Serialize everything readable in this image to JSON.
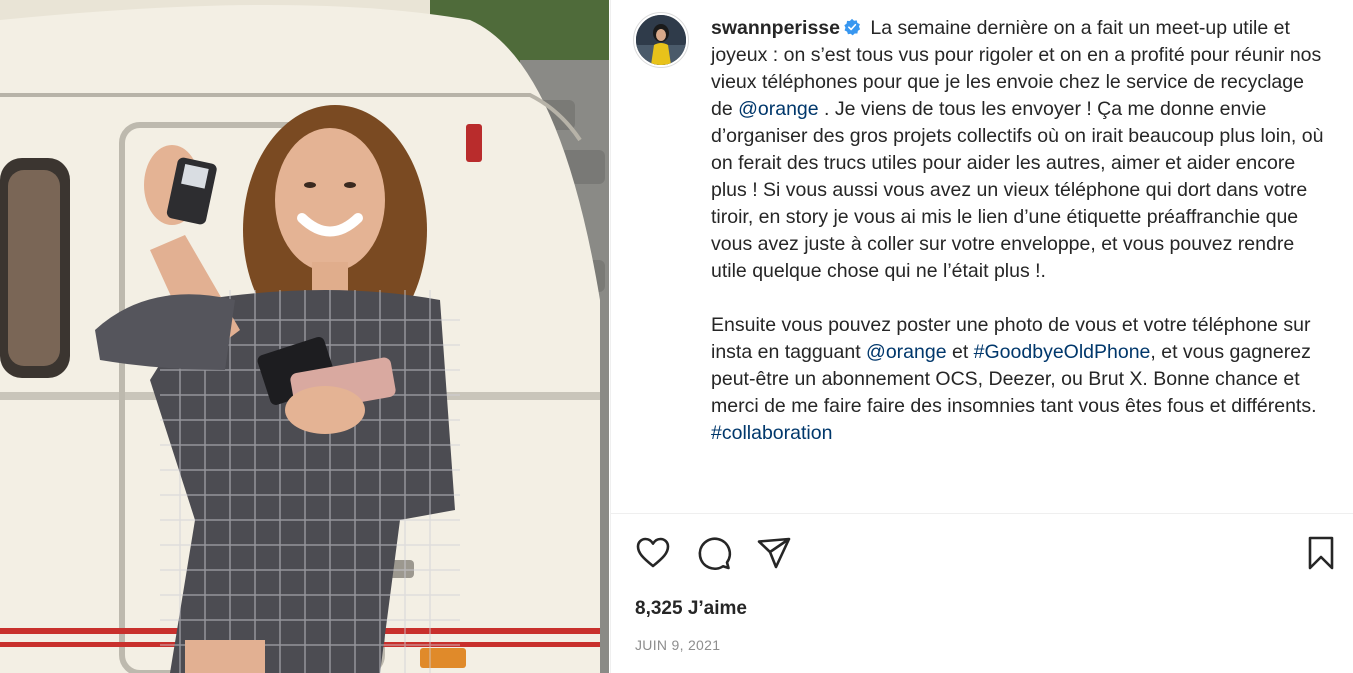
{
  "post": {
    "username": "swannperisse",
    "caption_para1": [
      {
        "text": " La semaine dernière on a fait un meet-up utile et joyeux : on s’est tous vus pour rigoler et on en a profité pour réunir nos vieux téléphones pour que je les envoie chez le service de recyclage de ",
        "type": "text"
      },
      {
        "text": "@orange",
        "type": "link"
      },
      {
        "text": " . Je viens de tous les envoyer ! Ça me donne envie d’organiser des gros projets collectifs où on irait beaucoup plus loin, où on ferait des trucs utiles pour aider les autres, aimer et aider encore plus ! Si vous aussi vous avez un vieux téléphone qui dort dans votre tiroir, en story je vous ai mis le lien d’une étiquette préaffranchie que vous avez juste à coller sur votre enveloppe, et vous pouvez rendre utile quelque chose qui ne l’était plus !.",
        "type": "text"
      }
    ],
    "caption_para2": [
      {
        "text": "Ensuite vous pouvez poster une photo de vous et votre téléphone sur insta en tagguant ",
        "type": "text"
      },
      {
        "text": "@orange",
        "type": "link"
      },
      {
        "text": " et ",
        "type": "text"
      },
      {
        "text": "#GoodbyeOldPhone",
        "type": "link"
      },
      {
        "text": ", et vous gagnerez peut-être un abonnement OCS, Deezer, ou Brut X. Bonne chance et merci de me faire faire des insomnies tant vous êtes fous et différents. ",
        "type": "text"
      },
      {
        "text": "#collaboration",
        "type": "link"
      }
    ],
    "likes": "8,325 J’aime",
    "date": "JUIN 9, 2021"
  },
  "icons": {
    "like": "heart-icon",
    "comment": "comment-icon",
    "share": "paper-plane-icon",
    "save": "bookmark-icon",
    "verified": "verified-badge-icon"
  },
  "colors": {
    "text": "#262626",
    "link": "#00376b",
    "muted": "#8e8e8e",
    "verified": "#3897f0",
    "border": "#efefef"
  }
}
